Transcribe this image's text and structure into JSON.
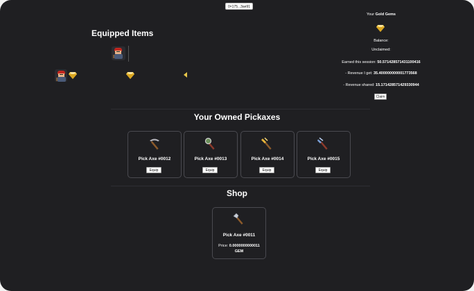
{
  "header": {
    "wallet_label": "0×175...3ae91"
  },
  "equipped": {
    "title": "Equipped Items"
  },
  "gems": {
    "title_prefix": "Your",
    "title_bold": "Gold Gems",
    "balance_label": "Balance:",
    "unclaimed_label": "Unclaimed:",
    "earned_label": "Earned this session:",
    "earned_value": "50.57142857143110041​6",
    "revenue_get_label": "- Revenue I get:",
    "revenue_get_value": "35.4000000000017735​68",
    "revenue_shared_label": "- Revenue shared:",
    "revenue_shared_value": "15.171428571429330944",
    "claim_label": "Claim"
  },
  "owned": {
    "title": "Your Owned Pickaxes",
    "items": [
      {
        "name": "Pick Axe #0012",
        "button": "Equip",
        "icon": "pickaxe-icon"
      },
      {
        "name": "Pick Axe #0013",
        "button": "Equip",
        "icon": "magnifier-pickaxe-icon"
      },
      {
        "name": "Pick Axe #0014",
        "button": "Equip",
        "icon": "gold-pickaxe-icon"
      },
      {
        "name": "Pick Axe #0015",
        "button": "Equip",
        "icon": "blue-pickaxe-icon"
      }
    ]
  },
  "shop": {
    "title": "Shop",
    "item": {
      "name": "Pick Axe #0011",
      "price_label": "Price:",
      "price_value": "0.0000000000011",
      "price_unit": "GEM",
      "icon": "axe-icon"
    }
  },
  "colors": {
    "background": "#1f1f22",
    "gem": "#f2c94c",
    "card_border": "#4a4a50"
  }
}
